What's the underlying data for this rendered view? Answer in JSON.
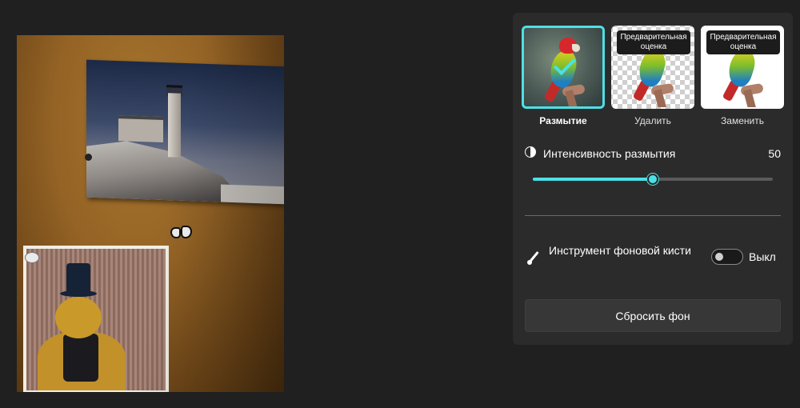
{
  "background_options": [
    {
      "label": "Размытие",
      "selected": true,
      "preview_badge": ""
    },
    {
      "label": "Удалить",
      "selected": false,
      "preview_badge": "Предварительная оценка"
    },
    {
      "label": "Заменить",
      "selected": false,
      "preview_badge": "Предварительная оценка"
    }
  ],
  "blur_intensity": {
    "label": "Интенсивность размытия",
    "value": "50",
    "fraction": 0.5
  },
  "background_brush": {
    "label": "Инструмент фоновой кисти",
    "toggle_state": "Выкл",
    "enabled": false
  },
  "reset_button": {
    "label": "Сбросить фон"
  },
  "colors": {
    "accent": "#4ce0e6",
    "panel_bg": "#2b2b2b",
    "app_bg": "#202020",
    "button_bg": "#373737"
  },
  "icons": {
    "intensity": "half-circle-icon",
    "brush": "brush-icon",
    "checkmark": "checkmark-icon"
  }
}
